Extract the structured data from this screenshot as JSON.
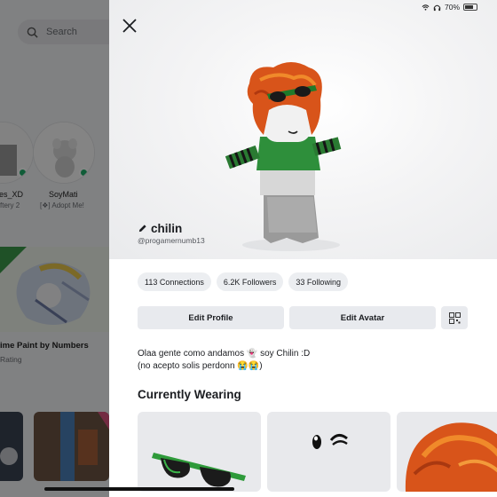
{
  "background_app": {
    "search_placeholder": "Search",
    "friends": [
      {
        "name": "es_XD",
        "status": "ftery 2"
      },
      {
        "name": "SoyMati",
        "status": "[❖] Adopt Me!"
      }
    ],
    "game": {
      "title": "ime Paint by Numbers",
      "rating": "Rating"
    }
  },
  "status_bar": {
    "battery": "70%"
  },
  "profile": {
    "display_name": "chilin",
    "username": "@progamernumb13",
    "stats": {
      "connections": "113 Connections",
      "followers": "6.2K Followers",
      "following": "33 Following"
    },
    "actions": {
      "edit_profile": "Edit Profile",
      "edit_avatar": "Edit Avatar"
    },
    "bio_line1": "Olaa gente como andamos 👻 soy Chilin :D",
    "bio_line2": "(no acepto solis perdonn 😭😭)",
    "currently_wearing_title": "Currently Wearing",
    "wearing_items": [
      "green-sunglasses",
      "wink-face",
      "orange-hair"
    ]
  },
  "colors": {
    "online": "#1fae6a",
    "pill_bg": "#eceef1",
    "button_bg": "#e8eaee",
    "accent_green": "#2b9a3a"
  },
  "icons": [
    "search-icon",
    "close-icon",
    "pencil-icon",
    "qr-code-icon",
    "wifi-icon",
    "headphones-icon",
    "battery-icon"
  ]
}
